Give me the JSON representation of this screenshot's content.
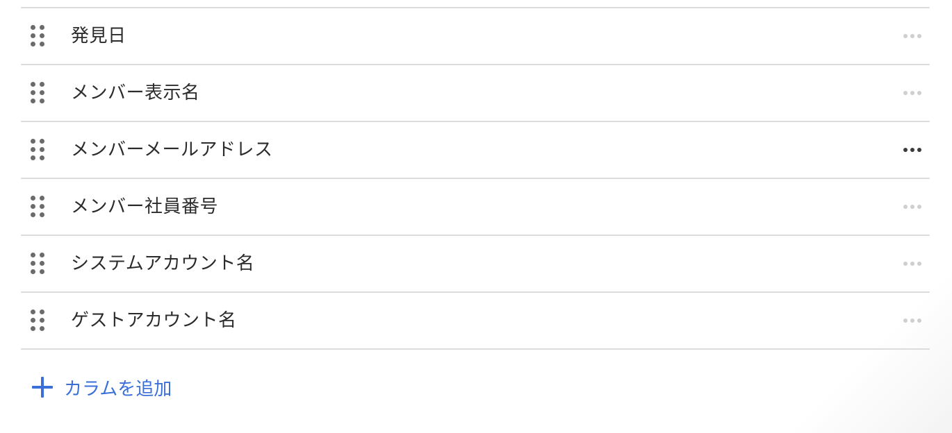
{
  "columns": [
    {
      "label": "発見日",
      "menu_active": false
    },
    {
      "label": "メンバー表示名",
      "menu_active": false
    },
    {
      "label": "メンバーメールアドレス",
      "menu_active": true
    },
    {
      "label": "メンバー社員番号",
      "menu_active": false
    },
    {
      "label": "システムアカウント名",
      "menu_active": false
    },
    {
      "label": "ゲストアカウント名",
      "menu_active": false
    }
  ],
  "add_column": {
    "label": "カラムを追加",
    "icon": "plus-icon"
  },
  "colors": {
    "accent": "#3a6fd8",
    "divider": "#dcdcdc",
    "text": "#2b2b2b",
    "menu_inactive": "#cfcfcf",
    "menu_active": "#3a3a3a"
  }
}
